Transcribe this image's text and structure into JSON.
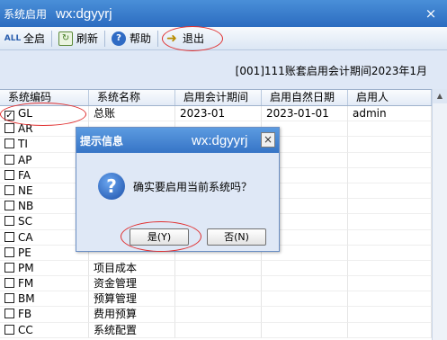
{
  "window": {
    "title": "系统启用",
    "watermark": "wx:dgyyrj",
    "close": "×"
  },
  "toolbar": {
    "enable_all": "全启",
    "refresh": "刷新",
    "help": "帮助",
    "exit": "退出",
    "enable_all_icon_text": "ALL",
    "help_icon_text": "?"
  },
  "period_info": "[001]111账套启用会计期间2023年1月",
  "table": {
    "headers": [
      "系统编码",
      "系统名称",
      "启用会计期间",
      "启用自然日期",
      "启用人"
    ],
    "rows": [
      {
        "code": "GL",
        "name": "总账",
        "period": "2023-01",
        "date": "2023-01-01",
        "user": "admin",
        "checked": true
      },
      {
        "code": "AR",
        "name": "",
        "period": "",
        "date": "",
        "user": "",
        "checked": false
      },
      {
        "code": "TI",
        "name": "",
        "period": "",
        "date": "",
        "user": "",
        "checked": false
      },
      {
        "code": "AP",
        "name": "",
        "period": "",
        "date": "",
        "user": "",
        "checked": false
      },
      {
        "code": "FA",
        "name": "",
        "period": "",
        "date": "",
        "user": "",
        "checked": false
      },
      {
        "code": "NE",
        "name": "",
        "period": "",
        "date": "",
        "user": "",
        "checked": false
      },
      {
        "code": "NB",
        "name": "",
        "period": "",
        "date": "",
        "user": "",
        "checked": false
      },
      {
        "code": "SC",
        "name": "",
        "period": "",
        "date": "",
        "user": "",
        "checked": false
      },
      {
        "code": "CA",
        "name": "",
        "period": "",
        "date": "",
        "user": "",
        "checked": false
      },
      {
        "code": "PE",
        "name": "",
        "period": "",
        "date": "",
        "user": "",
        "checked": false
      },
      {
        "code": "PM",
        "name": "项目成本",
        "period": "",
        "date": "",
        "user": "",
        "checked": false
      },
      {
        "code": "FM",
        "name": "资金管理",
        "period": "",
        "date": "",
        "user": "",
        "checked": false
      },
      {
        "code": "BM",
        "name": "预算管理",
        "period": "",
        "date": "",
        "user": "",
        "checked": false
      },
      {
        "code": "FB",
        "name": "费用预算",
        "period": "",
        "date": "",
        "user": "",
        "checked": false
      },
      {
        "code": "CC",
        "name": "系统配置",
        "period": "",
        "date": "",
        "user": "",
        "checked": false
      }
    ]
  },
  "dialog": {
    "title": "提示信息",
    "watermark": "wx:dgyyrj",
    "message": "确实要启用当前系统吗？",
    "yes": "是(Y)",
    "no": "否(N)",
    "close": "×",
    "icon_text": "?"
  },
  "colors": {
    "annotation": "#e03030",
    "titlebar": "#2b6cc0"
  }
}
